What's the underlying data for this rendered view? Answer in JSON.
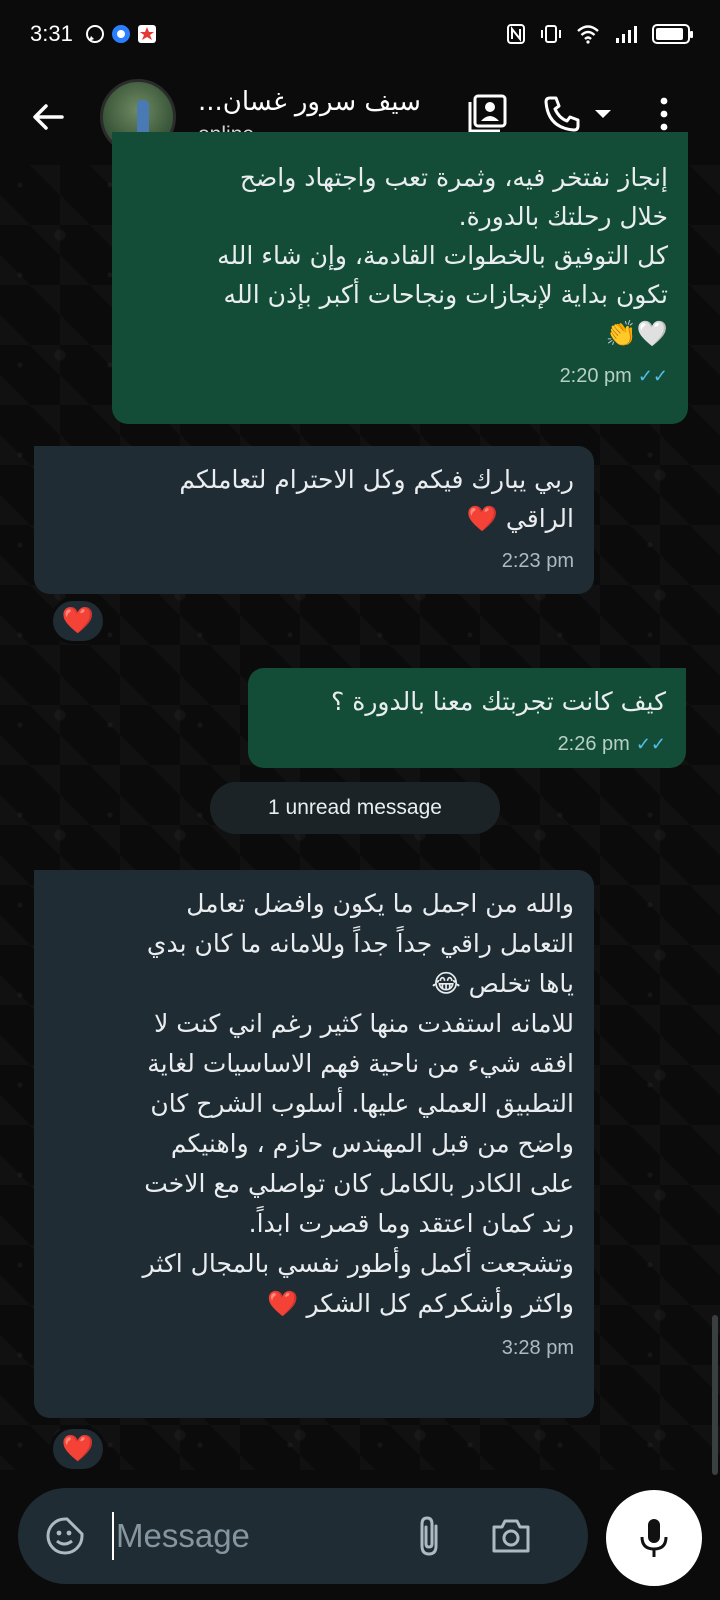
{
  "status_bar": {
    "time": "3:31",
    "battery_level": 0.9
  },
  "header": {
    "contact_name": "سيف سرور غسان...",
    "contact_status": "online",
    "icons": [
      "back-arrow-icon",
      "avatar",
      "contact-card-icon",
      "phone-icon",
      "dropdown-icon",
      "more-vert-icon"
    ]
  },
  "messages": [
    {
      "direction": "outgoing",
      "text": "إنجاز نفتخر فيه، وثمرة تعب واجتهاد واضح\nخلال رحلتك بالدورة.\nكل التوفيق بالخطوات القادمة، وإن شاء الله\nتكون بداية لإنجازات ونجاحات أكبر بإذن الله\n🤍👏",
      "time": "2:20 pm",
      "ticks": "✓✓"
    },
    {
      "direction": "incoming",
      "text": "ربي يبارك فيكم وكل الاحترام لتعاملكم\nالراقي ❤️",
      "time": "2:23 pm",
      "reaction": "❤️"
    },
    {
      "direction": "outgoing",
      "text": "كيف كانت تجربتك معنا بالدورة ؟",
      "time": "2:26 pm",
      "ticks": "✓✓"
    },
    {
      "direction": "incoming",
      "text": "والله من اجمل ما يكون وافضل تعامل\nالتعامل راقي جداً جداً    وللامانه ما كان بدي\nياها تخلص 😂\n للامانه استفدت منها كثير رغم اني كنت لا\nافقه شيء من ناحية فهم الاساسيات لغاية\nالتطبيق العملي عليها. أسلوب الشرح كان\nواضح من قبل المهندس حازم ،  واهنيكم\nعلى الكادر بالكامل كان تواصلي مع الاخت\nرند كمان اعتقد وما قصرت ابداً.\nوتشجعت أكمل وأطور نفسي بالمجال اكثر\nواكثر وأشكركم كل الشكر ❤️",
      "time": "3:28 pm",
      "reaction": "❤️"
    }
  ],
  "unread_banner": "1 unread message",
  "composer": {
    "placeholder": "Message"
  },
  "colors": {
    "background": "#0b0b0b",
    "outgoing_bubble": "#134d37",
    "incoming_bubble": "#202c33",
    "read_ticks": "#53bdeb"
  }
}
